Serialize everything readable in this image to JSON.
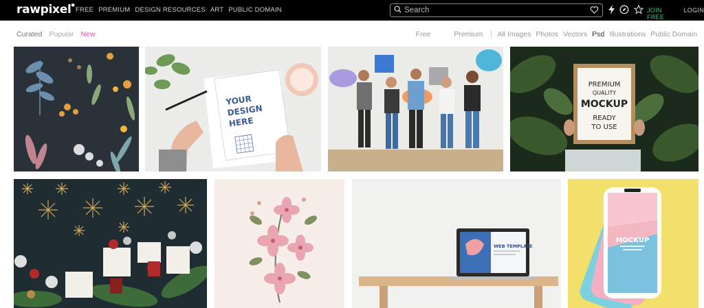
{
  "header": {
    "logo": "rawpixel",
    "nav": [
      "FREE",
      "PREMIUM",
      "DESIGN RESOURCES",
      "ART",
      "PUBLIC DOMAIN"
    ],
    "search_placeholder": "Search",
    "join_label": "JOIN FREE",
    "login_label": "LOGIN",
    "icons": [
      "heart-icon",
      "lightning-icon",
      "compass-icon",
      "star-icon"
    ]
  },
  "subnav": {
    "left": [
      "Curated",
      "Popular",
      "New"
    ],
    "right_primary": [
      "Free",
      "Premium"
    ],
    "right_types": [
      "All Images",
      "Photos",
      "Vectors",
      "Psd",
      "Illustrations",
      "Public Domain"
    ]
  },
  "tiles": {
    "design_text": [
      "YOUR",
      "DESIGN",
      "HERE"
    ],
    "mockup_text": [
      "PREMIUM",
      "QUALITY",
      "MOCKUP",
      "READY",
      "TO USE"
    ],
    "web_template_text": "WEB TEMPLATE",
    "phone_mockup_text": "MOCKUP"
  },
  "colors": {
    "active_filter": "#e34bb0",
    "join_green": "#3ec77a",
    "header_bg": "#000000"
  }
}
